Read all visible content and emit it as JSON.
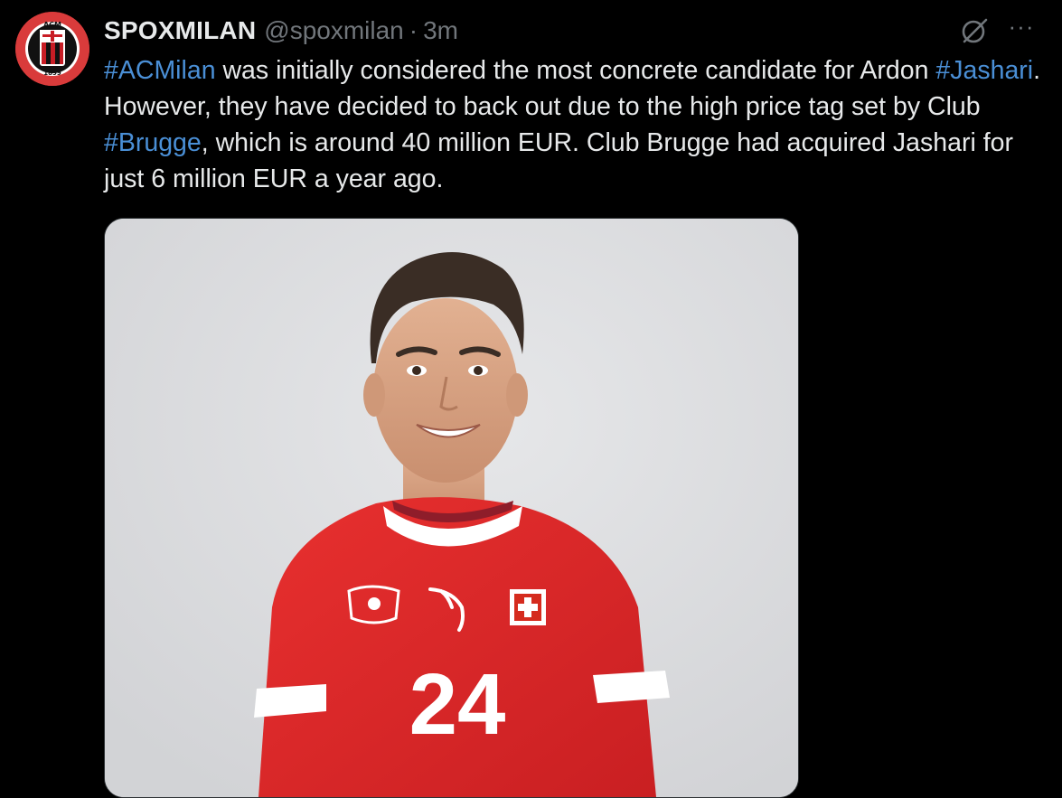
{
  "tweet": {
    "author": {
      "name": "SPOXMILAN",
      "handle": "@spoxmilan",
      "avatar_icon": "ac-milan-crest-icon",
      "avatar_text": "ACM 1899"
    },
    "separator": "·",
    "time": "3m",
    "actions": {
      "grok_icon": "grok-icon",
      "more_label": "···"
    },
    "text": {
      "hashtag_1": "#ACMilan",
      "part_1": " was initially considered the most concrete candidate for Ardon ",
      "hashtag_2": "#Jashari",
      "part_2": ". However, they have decided to back out due to the high price tag set by Club ",
      "hashtag_3": "#Brugge",
      "part_3": ", which is around 40 million EUR. Club Brugge had acquired Jashari for just 6 million EUR a year ago."
    },
    "media": {
      "jersey_number": "24",
      "brand_icon": "puma-logo-icon",
      "flag_icon": "swiss-cross-icon",
      "crest_icon": "swiss-football-crest-icon"
    }
  },
  "colors": {
    "background": "#000000",
    "text": "#e7e9ea",
    "muted": "#71767b",
    "hashtag": "#4a8fd6",
    "jersey_red": "#e1272a"
  }
}
